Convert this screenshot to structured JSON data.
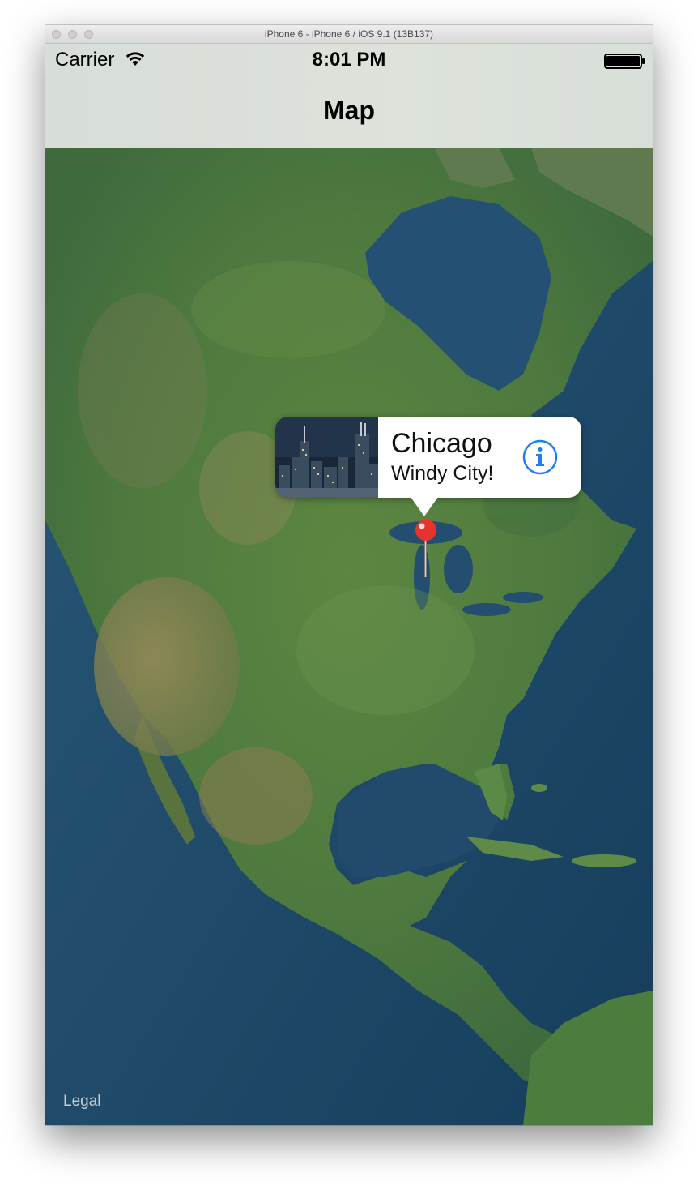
{
  "window": {
    "title": "iPhone 6 - iPhone 6 / iOS 9.1 (13B137)"
  },
  "status_bar": {
    "carrier": "Carrier",
    "time": "8:01 PM"
  },
  "nav_bar": {
    "title": "Map"
  },
  "annotation": {
    "title": "Chicago",
    "subtitle": "Windy City!",
    "image_icon": "chicago-skyline-thumbnail",
    "accessory_icon": "info-icon",
    "pin_color": "#e8322e"
  },
  "map": {
    "type": "satellite",
    "legal_label": "Legal"
  },
  "colors": {
    "accent": "#1f7ff0",
    "nav_bar": "#dbe1da",
    "ocean": "#1e4a6e"
  }
}
